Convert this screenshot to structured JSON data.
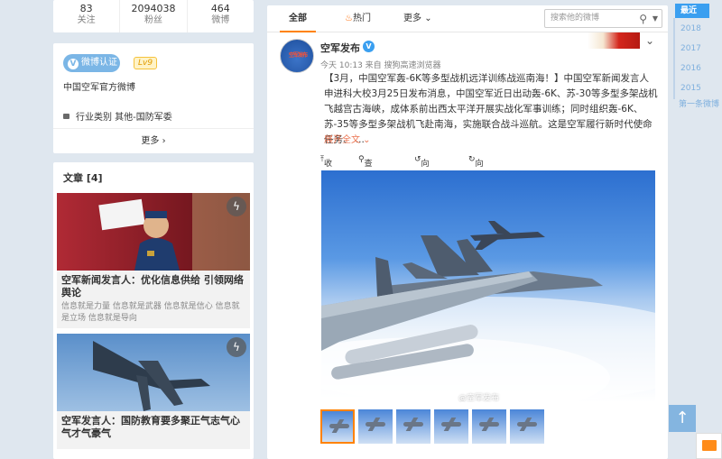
{
  "stats": [
    {
      "value": "83",
      "label": "关注"
    },
    {
      "value": "2094038",
      "label": "粉丝"
    },
    {
      "value": "464",
      "label": "微博"
    }
  ],
  "profile": {
    "verify_label": "微博认证",
    "level": "Lv9",
    "description": "中国空军官方微博",
    "industry": "行业类别 其他-国防军委",
    "more": "更多 ›"
  },
  "articles": {
    "title": "文章 [4]",
    "items": [
      {
        "title": "空军新闻发言人：优化信息供给 引领网络舆论",
        "snippet": "信息就是力量 信息就是武器 信息就是信心 信息就是立场 信息就是导向"
      },
      {
        "title": "空军发言人：国防教育要多聚正气志气心气才气豪气",
        "snippet": ""
      }
    ]
  },
  "feed": {
    "tabs": [
      "全部",
      "热门",
      "更多"
    ],
    "search_placeholder": "搜索他的微博",
    "post": {
      "user": "空军发布",
      "avatar_text": "空军发布",
      "meta": "今天 10:13 来自 搜狗高速浏览器",
      "text": "【3月，中国空军轰-6K等多型战机远洋训练战巡南海！】中国空军新闻发言人申进科大校3月25日发布消息，中国空军近日出动轰-6K、苏-30等多型多架战机飞越宫古海峡，成体系前出西太平洋开展实战化军事训练；同时组织轰-6K、苏-35等多型多架战机飞赴南海，实施联合战斗巡航。这是空军履行新时代使命任务、 ...",
      "expand": "展开全文 ⌄",
      "toolbar": [
        "收起",
        "查看大图",
        "向左旋转",
        "向右旋转"
      ],
      "watermark": "@空军发布",
      "thumb_count": 6
    }
  },
  "timeline": {
    "active": "最近",
    "years": [
      "2018",
      "2017",
      "2016",
      "2015"
    ],
    "last": "第一条微博"
  },
  "icons": {
    "back_top": "arrow-up-icon",
    "mail": "mail-icon"
  },
  "colors": {
    "accent": "#ff8200",
    "link": "#eb7350",
    "timeline_active": "#3a9ff0"
  }
}
